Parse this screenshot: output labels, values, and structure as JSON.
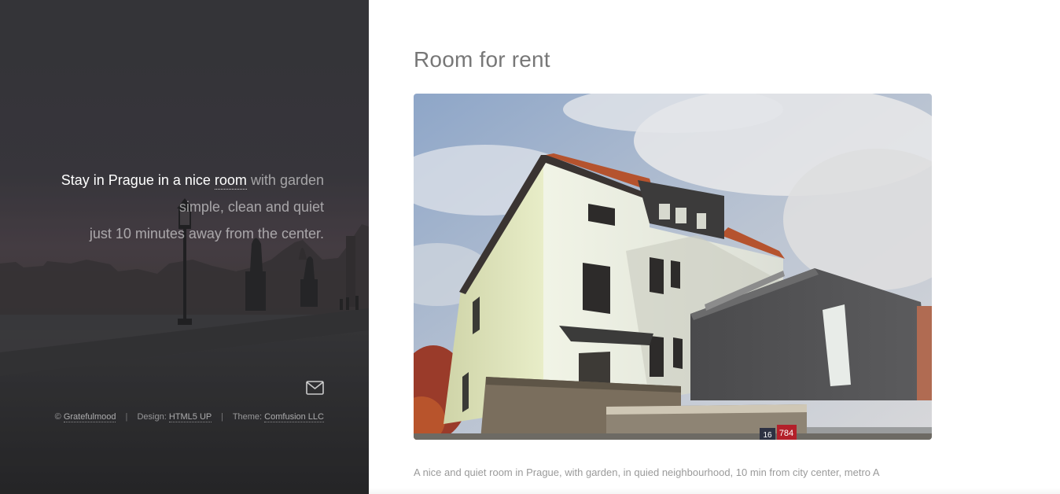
{
  "header": {
    "tagline": {
      "line1_strong": "Stay in Prague in a nice",
      "line1_link": "room",
      "line1_rest": "with garden",
      "line2": "simple, clean and quiet",
      "line3": "just 10 minutes away from the center."
    },
    "icons": {
      "contact": "envelope-icon"
    },
    "footer": {
      "copy_symbol": "©",
      "copy_name": "Gratefulmood",
      "design_label": "Design:",
      "design_link": "HTML5 UP",
      "theme_label": "Theme:",
      "theme_link": "Comfusion LLC",
      "separator": "|"
    }
  },
  "main": {
    "title": "Room for rent",
    "photo": {
      "house_number_left": "16",
      "house_number_right": "784"
    },
    "description": "A nice and quiet room in Prague, with garden, in quied neighbourhood, 10 min from city center, metro A"
  },
  "colors": {
    "title": "#777777",
    "body_text": "#9a9a9a",
    "panel_dark": "#2f2e30"
  }
}
